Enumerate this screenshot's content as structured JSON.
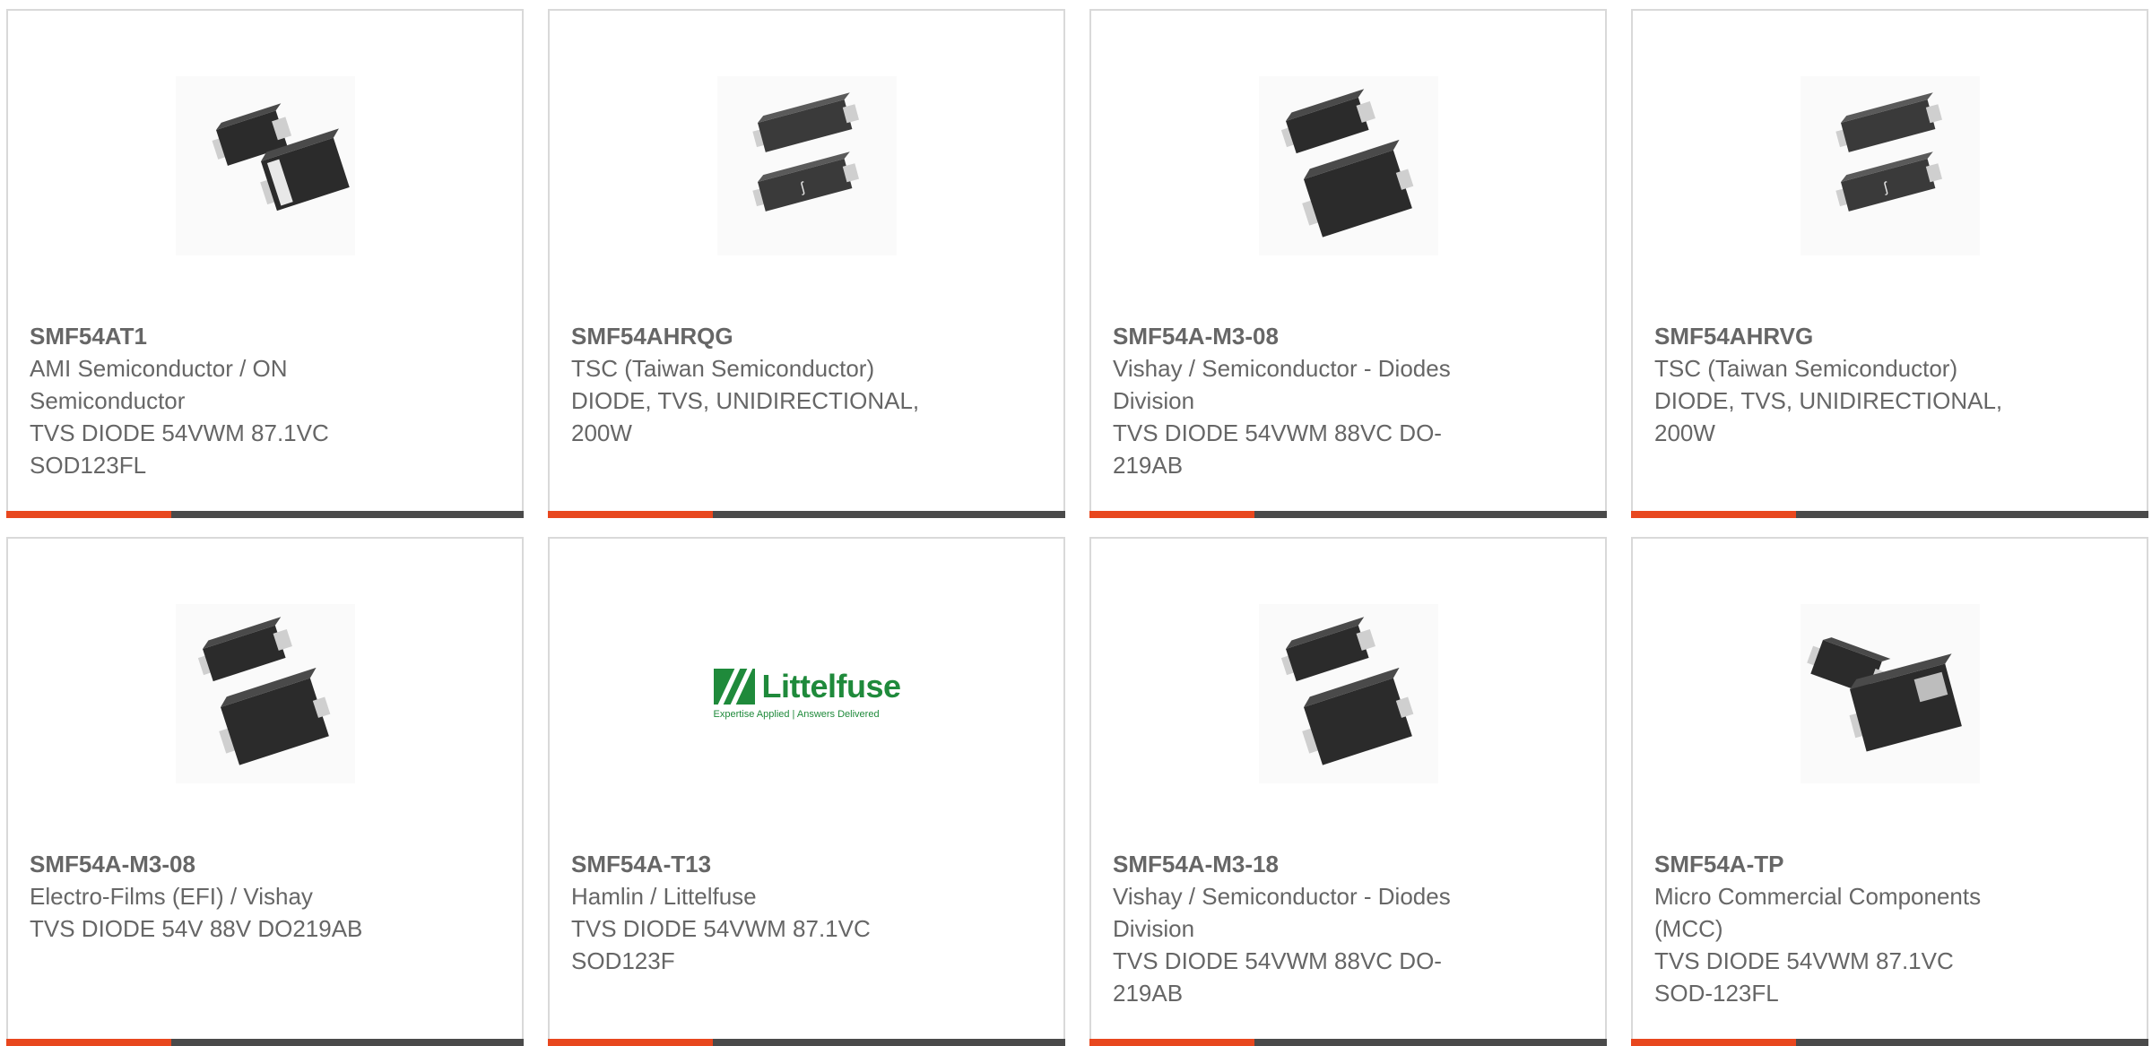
{
  "colors": {
    "accent": "#e8471e",
    "bar": "#4a4a4a",
    "text": "#666666",
    "border": "#d9d9d9"
  },
  "cards": [
    {
      "part": "SMF54AT1",
      "manufacturer": "AMI Semiconductor / ON Semiconductor",
      "description": "TVS DIODE 54VWM 87.1VC SOD123FL",
      "image": "diode-sod123fl-pair"
    },
    {
      "part": "SMF54AHRQG",
      "manufacturer": "TSC (Taiwan Semiconductor)",
      "description": "DIODE, TVS, UNIDIRECTIONAL, 200W",
      "image": "diode-tsc-pair"
    },
    {
      "part": "SMF54A-M3-08",
      "manufacturer": "Vishay / Semiconductor - Diodes Division",
      "description": "TVS DIODE 54VWM 88VC DO-219AB",
      "image": "diode-do219ab-pair"
    },
    {
      "part": "SMF54AHRVG",
      "manufacturer": "TSC (Taiwan Semiconductor)",
      "description": "DIODE, TVS, UNIDIRECTIONAL, 200W",
      "image": "diode-tsc-pair"
    },
    {
      "part": "SMF54A-M3-08",
      "manufacturer": "Electro-Films (EFI) / Vishay",
      "description": "TVS DIODE 54V 88V DO219AB",
      "image": "diode-do219ab-pair"
    },
    {
      "part": "SMF54A-T13",
      "manufacturer": "Hamlin / Littelfuse",
      "description": "TVS DIODE 54VWM 87.1VC SOD123F",
      "image": "littelfuse-logo",
      "logo": {
        "word": "Littelfuse",
        "tagline": "Expertise Applied | Answers Delivered"
      }
    },
    {
      "part": "SMF54A-M3-18",
      "manufacturer": "Vishay / Semiconductor - Diodes Division",
      "description": "TVS DIODE 54VWM 88VC DO-219AB",
      "image": "diode-do219ab-pair"
    },
    {
      "part": "SMF54A-TP",
      "manufacturer": "Micro Commercial Components (MCC)",
      "description": "TVS DIODE 54VWM 87.1VC SOD-123FL",
      "image": "diode-mcc-pair"
    }
  ]
}
